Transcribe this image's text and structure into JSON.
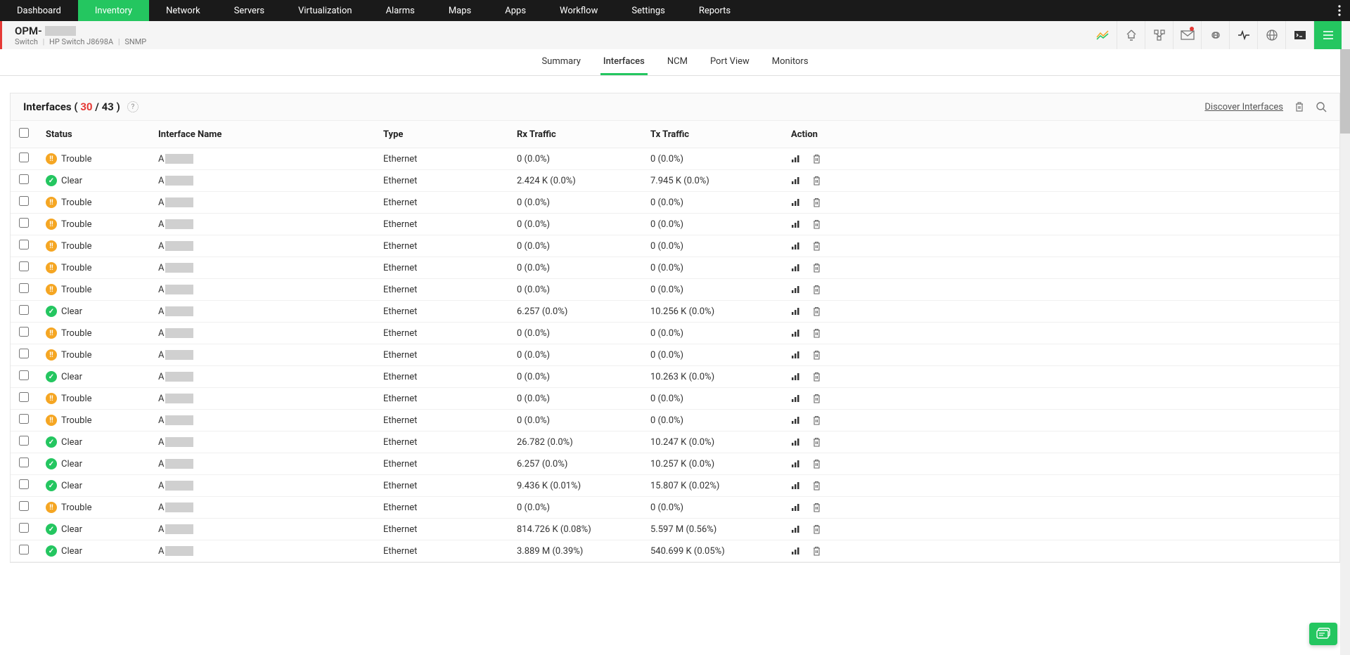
{
  "topnav": {
    "items": [
      "Dashboard",
      "Inventory",
      "Network",
      "Servers",
      "Virtualization",
      "Alarms",
      "Maps",
      "Apps",
      "Workflow",
      "Settings",
      "Reports"
    ],
    "active_index": 1
  },
  "device": {
    "name_prefix": "OPM-",
    "sub_type": "Switch",
    "sub_model": "HP Switch J8698A",
    "sub_proto": "SNMP"
  },
  "subtabs": {
    "items": [
      "Summary",
      "Interfaces",
      "NCM",
      "Port View",
      "Monitors"
    ],
    "active_index": 1
  },
  "panel": {
    "title_prefix": "Interfaces (",
    "count_a": "30",
    "count_sep": " / ",
    "count_b": "43",
    "title_suffix": " )",
    "help": "?",
    "discover_label": "Discover Interfaces"
  },
  "columns": {
    "status": "Status",
    "name": "Interface Name",
    "type": "Type",
    "rx": "Rx Traffic",
    "tx": "Tx Traffic",
    "action": "Action"
  },
  "rows": [
    {
      "status": "Trouble",
      "sclass": "trouble",
      "sico": "!!",
      "name_prefix": "A",
      "type": "Ethernet",
      "rx": "0 (0.0%)",
      "tx": "0 (0.0%)"
    },
    {
      "status": "Clear",
      "sclass": "clear",
      "sico": "✓",
      "name_prefix": "A",
      "type": "Ethernet",
      "rx": "2.424 K (0.0%)",
      "tx": "7.945 K (0.0%)"
    },
    {
      "status": "Trouble",
      "sclass": "trouble",
      "sico": "!!",
      "name_prefix": "A",
      "type": "Ethernet",
      "rx": "0 (0.0%)",
      "tx": "0 (0.0%)"
    },
    {
      "status": "Trouble",
      "sclass": "trouble",
      "sico": "!!",
      "name_prefix": "A",
      "type": "Ethernet",
      "rx": "0 (0.0%)",
      "tx": "0 (0.0%)"
    },
    {
      "status": "Trouble",
      "sclass": "trouble",
      "sico": "!!",
      "name_prefix": "A",
      "type": "Ethernet",
      "rx": "0 (0.0%)",
      "tx": "0 (0.0%)"
    },
    {
      "status": "Trouble",
      "sclass": "trouble",
      "sico": "!!",
      "name_prefix": "A",
      "type": "Ethernet",
      "rx": "0 (0.0%)",
      "tx": "0 (0.0%)"
    },
    {
      "status": "Trouble",
      "sclass": "trouble",
      "sico": "!!",
      "name_prefix": "A",
      "type": "Ethernet",
      "rx": "0 (0.0%)",
      "tx": "0 (0.0%)"
    },
    {
      "status": "Clear",
      "sclass": "clear",
      "sico": "✓",
      "name_prefix": "A",
      "type": "Ethernet",
      "rx": "6.257 (0.0%)",
      "tx": "10.256 K (0.0%)"
    },
    {
      "status": "Trouble",
      "sclass": "trouble",
      "sico": "!!",
      "name_prefix": "A",
      "type": "Ethernet",
      "rx": "0 (0.0%)",
      "tx": "0 (0.0%)"
    },
    {
      "status": "Trouble",
      "sclass": "trouble",
      "sico": "!!",
      "name_prefix": "A",
      "type": "Ethernet",
      "rx": "0 (0.0%)",
      "tx": "0 (0.0%)"
    },
    {
      "status": "Clear",
      "sclass": "clear",
      "sico": "✓",
      "name_prefix": "A",
      "type": "Ethernet",
      "rx": "0 (0.0%)",
      "tx": "10.263 K (0.0%)"
    },
    {
      "status": "Trouble",
      "sclass": "trouble",
      "sico": "!!",
      "name_prefix": "A",
      "type": "Ethernet",
      "rx": "0 (0.0%)",
      "tx": "0 (0.0%)"
    },
    {
      "status": "Trouble",
      "sclass": "trouble",
      "sico": "!!",
      "name_prefix": "A",
      "type": "Ethernet",
      "rx": "0 (0.0%)",
      "tx": "0 (0.0%)"
    },
    {
      "status": "Clear",
      "sclass": "clear",
      "sico": "✓",
      "name_prefix": "A",
      "type": "Ethernet",
      "rx": "26.782 (0.0%)",
      "tx": "10.247 K (0.0%)"
    },
    {
      "status": "Clear",
      "sclass": "clear",
      "sico": "✓",
      "name_prefix": "A",
      "type": "Ethernet",
      "rx": "6.257 (0.0%)",
      "tx": "10.257 K (0.0%)"
    },
    {
      "status": "Clear",
      "sclass": "clear",
      "sico": "✓",
      "name_prefix": "A",
      "type": "Ethernet",
      "rx": "9.436 K (0.01%)",
      "tx": "15.807 K (0.02%)"
    },
    {
      "status": "Trouble",
      "sclass": "trouble",
      "sico": "!!",
      "name_prefix": "A",
      "type": "Ethernet",
      "rx": "0 (0.0%)",
      "tx": "0 (0.0%)"
    },
    {
      "status": "Clear",
      "sclass": "clear",
      "sico": "✓",
      "name_prefix": "A",
      "type": "Ethernet",
      "rx": "814.726 K (0.08%)",
      "tx": "5.597 M (0.56%)"
    },
    {
      "status": "Clear",
      "sclass": "clear",
      "sico": "✓",
      "name_prefix": "A",
      "type": "Ethernet",
      "rx": "3.889 M (0.39%)",
      "tx": "540.699 K (0.05%)"
    }
  ]
}
